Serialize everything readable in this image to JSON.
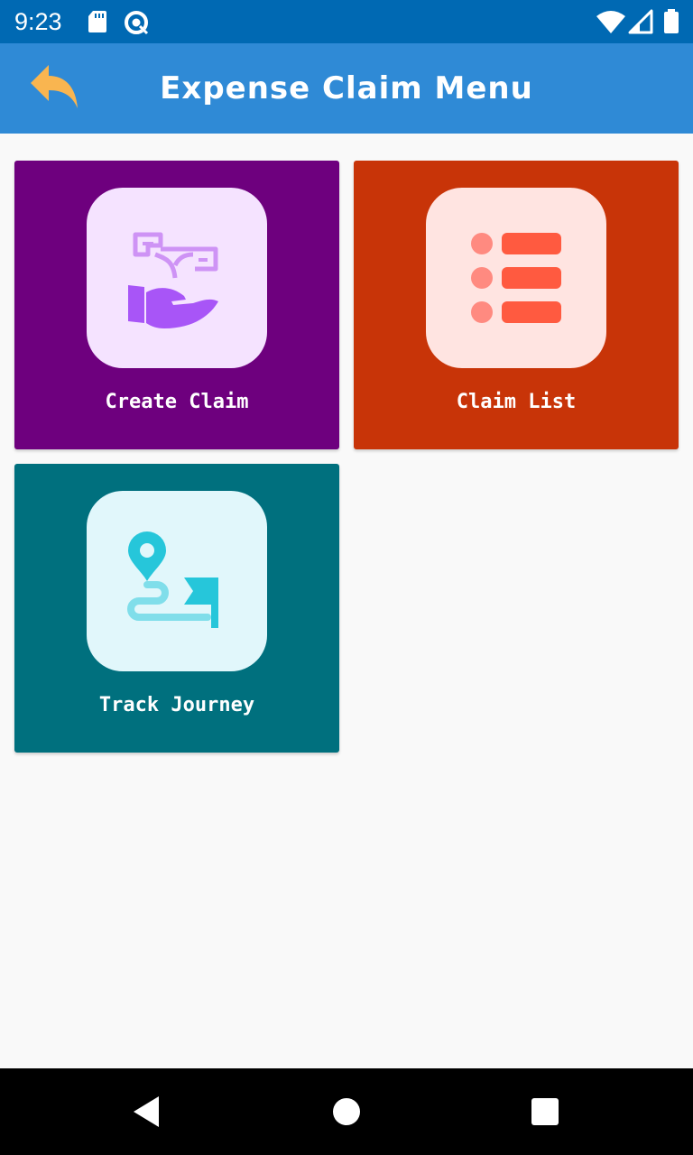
{
  "status_bar": {
    "time": "9:23",
    "icons": [
      "sd-card-icon",
      "sync-icon",
      "wifi-icon",
      "signal-icon",
      "battery-icon"
    ]
  },
  "app_bar": {
    "title": "Expense Claim Menu",
    "back_icon": "back-arrow-icon",
    "back_icon_color": "#F9B550"
  },
  "colors": {
    "status_bar": "#0069B3",
    "app_bar": "#2F8AD6",
    "background": "#F9F9F9"
  },
  "menu": {
    "items": [
      {
        "label": "Create Claim",
        "icon": "money-hand-icon",
        "color": "#6E007E",
        "icon_bg": "#F5E3FF"
      },
      {
        "label": "Claim List",
        "icon": "list-icon",
        "color": "#C83408",
        "icon_bg": "#FFE4E1"
      },
      {
        "label": "Track Journey",
        "icon": "journey-route-icon",
        "color": "#00707E",
        "icon_bg": "#E1F7FB"
      }
    ]
  },
  "nav_bar": {
    "buttons": [
      "back-triangle-icon",
      "home-circle-icon",
      "recents-square-icon"
    ]
  }
}
